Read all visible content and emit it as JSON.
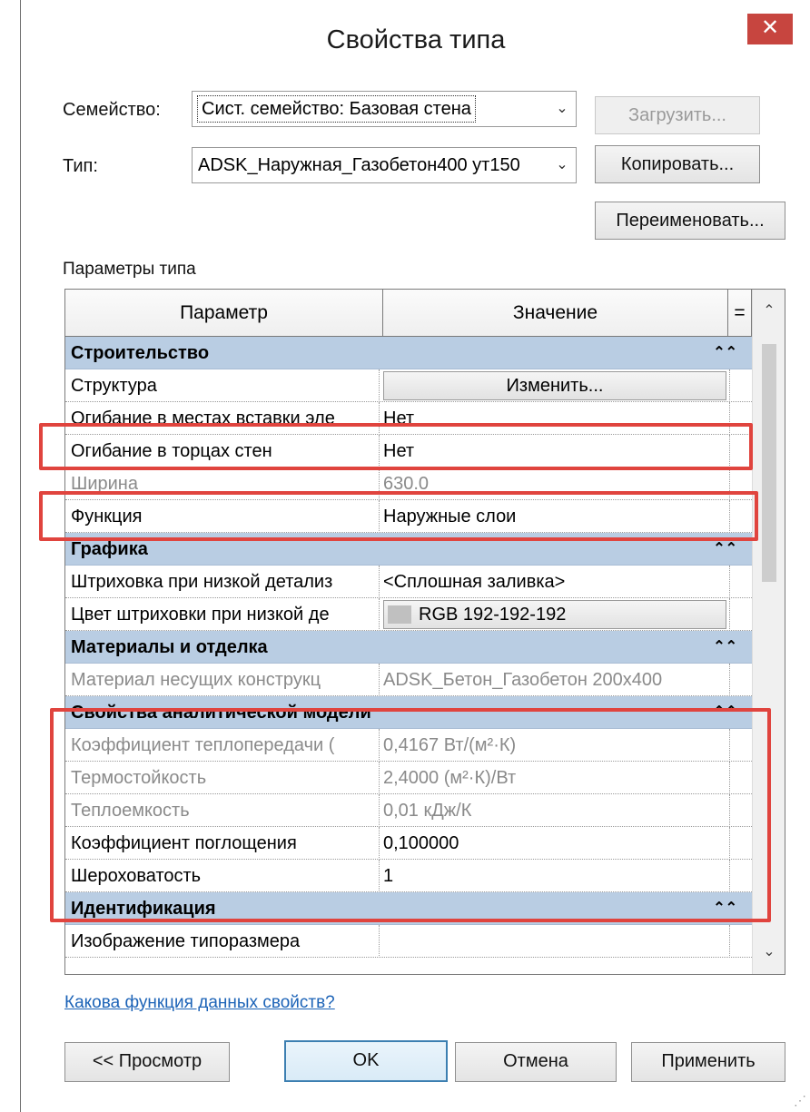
{
  "dialog": {
    "title": "Свойства типа",
    "close_glyph": "✕"
  },
  "family": {
    "label": "Семейство:",
    "value": "Сист. семейство: Базовая стена"
  },
  "type": {
    "label": "Тип:",
    "value": "ADSK_Наружная_Газобетон400 ут150"
  },
  "buttons": {
    "load": "Загрузить...",
    "copy": "Копировать...",
    "rename": "Переименовать...",
    "preview": "<< Просмотр",
    "ok": "OK",
    "cancel": "Отмена",
    "apply": "Применить"
  },
  "section_label": "Параметры типа",
  "grid": {
    "header_param": "Параметр",
    "header_value": "Значение",
    "header_eq": "=",
    "collapse_glyph": "⌃⌃",
    "groups": [
      {
        "name": "Строительство"
      },
      {
        "name": "Графика"
      },
      {
        "name": "Материалы и отделка"
      },
      {
        "name": "Свойства аналитической модели"
      },
      {
        "name": "Идентификация"
      }
    ],
    "rows": [
      {
        "param": "Структура",
        "value": "Изменить..."
      },
      {
        "param": "Огибание в местах вставки эле",
        "value": "Нет"
      },
      {
        "param": "Огибание в торцах стен",
        "value": "Нет"
      },
      {
        "param": "Ширина",
        "value": "630.0"
      },
      {
        "param": "Функция",
        "value": "Наружные слои"
      },
      {
        "param": "Штриховка при низкой детализ",
        "value": "<Сплошная заливка>"
      },
      {
        "param": "Цвет штриховки при низкой де",
        "value": "RGB 192-192-192"
      },
      {
        "param": "Материал несущих конструкц",
        "value": "ADSK_Бетон_Газобетон 200x400"
      },
      {
        "param": "Коэффициент теплопередачи (",
        "value": "0,4167 Вт/(м²·К)"
      },
      {
        "param": "Термостойкость",
        "value": "2,4000 (м²·К)/Вт"
      },
      {
        "param": "Теплоемкость",
        "value": "0,01 кДж/К"
      },
      {
        "param": "Коэффициент поглощения",
        "value": "0,100000"
      },
      {
        "param": "Шероховатость",
        "value": "1"
      },
      {
        "param": "Изображение типоразмера",
        "value": ""
      }
    ]
  },
  "help_link": "Какова функция данных свойств?",
  "colors": {
    "group_band": "#b9cde3",
    "highlight": "#e0443e",
    "close": "#c7453f"
  }
}
